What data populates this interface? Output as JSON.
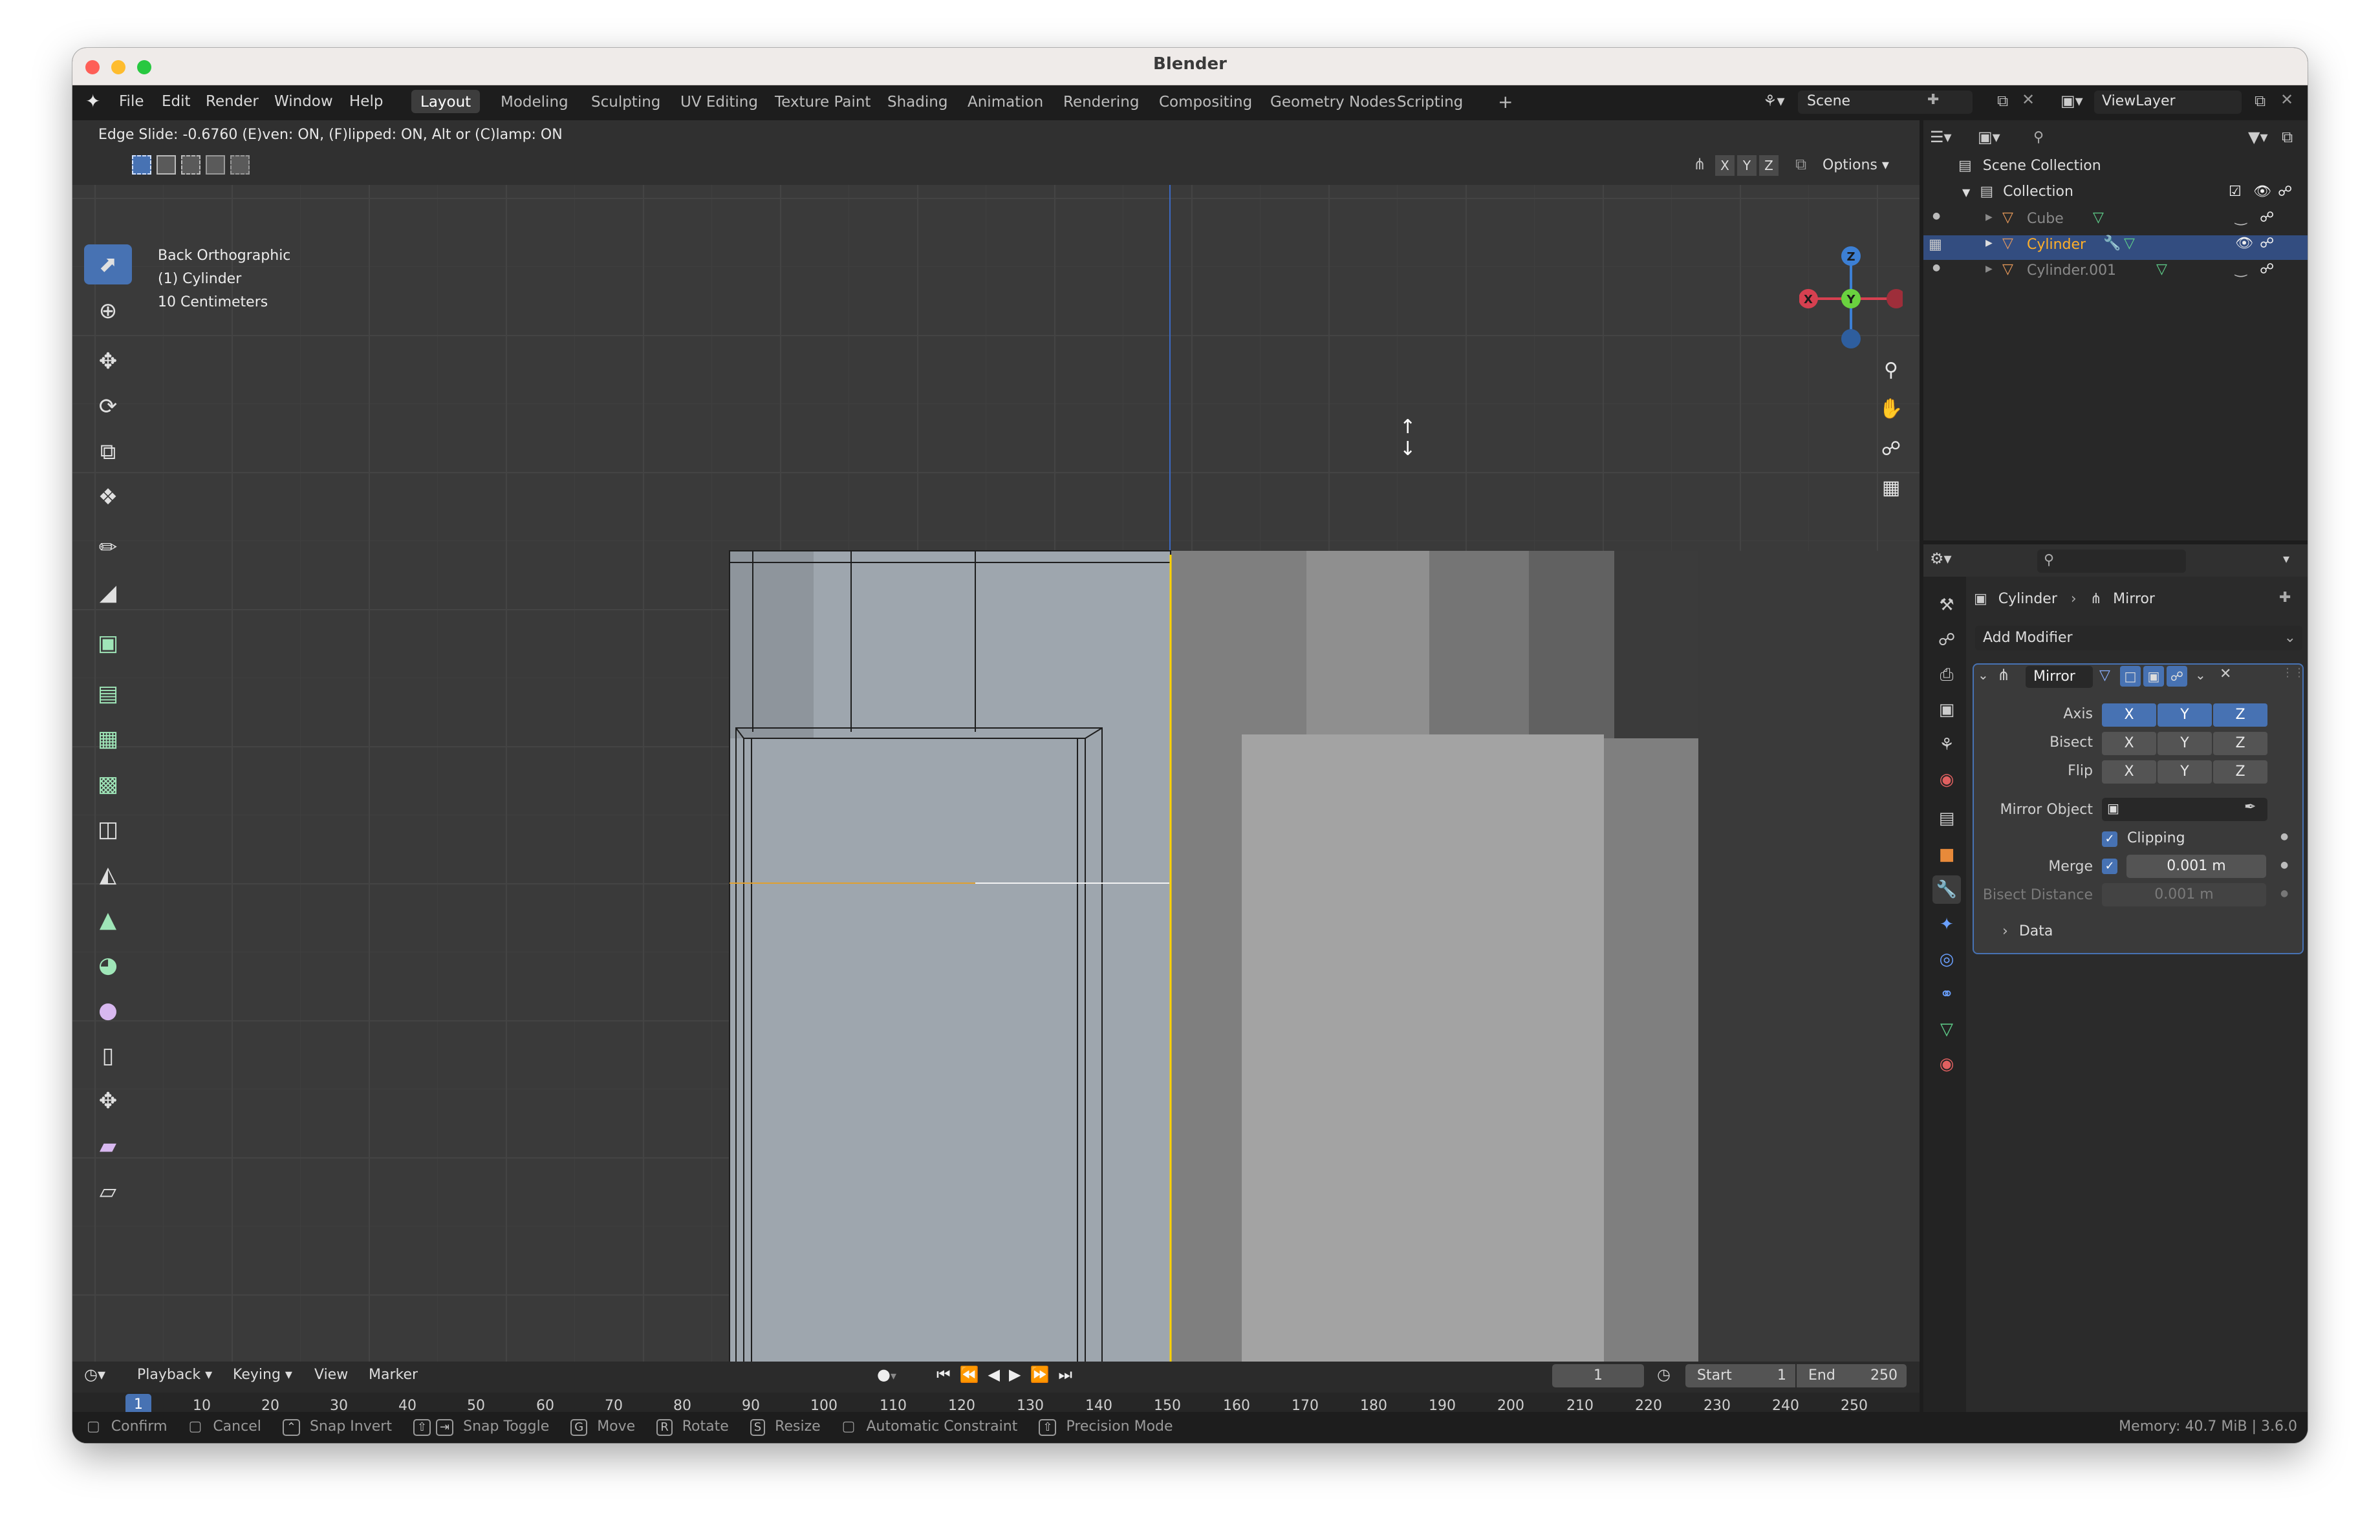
{
  "window": {
    "title": "Blender"
  },
  "menubar": {
    "items": [
      "File",
      "Edit",
      "Render",
      "Window",
      "Help"
    ]
  },
  "workspaces": {
    "tabs": [
      "Layout",
      "Modeling",
      "Sculpting",
      "UV Editing",
      "Texture Paint",
      "Shading",
      "Animation",
      "Rendering",
      "Compositing",
      "Geometry Nodes",
      "Scripting"
    ],
    "active": "Layout",
    "add_label": "+"
  },
  "scene": {
    "name": "Scene",
    "view_layer": "ViewLayer"
  },
  "header_status": "Edge Slide: -0.6760 (E)ven: ON, (F)lipped: ON, Alt or (C)lamp: ON",
  "viewport": {
    "view_name": "Back Orthographic",
    "object_label": "(1) Cylinder",
    "scale_label": "10 Centimeters",
    "axis_x": "X",
    "axis_y": "Y",
    "axis_z": "Z",
    "options_label": "Options",
    "gizmo": {
      "x": "X",
      "y": "Y",
      "z": "Z"
    }
  },
  "outliner": {
    "scene_collection": "Scene Collection",
    "collection": "Collection",
    "objects": [
      {
        "name": "Cube",
        "selected": false
      },
      {
        "name": "Cylinder",
        "selected": true
      },
      {
        "name": "Cylinder.001",
        "selected": false
      }
    ]
  },
  "properties": {
    "breadcrumb_object": "Cylinder",
    "breadcrumb_modifier": "Mirror",
    "add_modifier": "Add Modifier",
    "modifier_name": "Mirror",
    "axis_label": "Axis",
    "bisect_label": "Bisect",
    "flip_label": "Flip",
    "x": "X",
    "y": "Y",
    "z": "Z",
    "mirror_object_label": "Mirror Object",
    "clipping_label": "Clipping",
    "merge_label": "Merge",
    "merge_value": "0.001 m",
    "bisect_distance_label": "Bisect Distance",
    "bisect_distance_value": "0.001 m",
    "data_label": "Data"
  },
  "timeline": {
    "menus": [
      "Playback",
      "Keying",
      "View",
      "Marker"
    ],
    "current_frame": "1",
    "start_label": "Start",
    "start_value": "1",
    "end_label": "End",
    "end_value": "250",
    "playhead": "1",
    "ticks": [
      "10",
      "20",
      "30",
      "40",
      "50",
      "60",
      "70",
      "80",
      "90",
      "100",
      "110",
      "120",
      "130",
      "140",
      "150",
      "160",
      "170",
      "180",
      "190",
      "200",
      "210",
      "220",
      "230",
      "240",
      "250"
    ]
  },
  "statusbar": {
    "confirm": "Confirm",
    "cancel": "Cancel",
    "snap_invert": "Snap Invert",
    "snap_toggle": "Snap Toggle",
    "move_key": "G",
    "move": "Move",
    "rotate_key": "R",
    "rotate": "Rotate",
    "resize_key": "S",
    "resize": "Resize",
    "auto_constraint": "Automatic Constraint",
    "precision": "Precision Mode",
    "memory": "Memory: 40.7 MiB | 3.6.0"
  },
  "colors": {
    "accent": "#4772b3",
    "selected_text": "#ffaf29",
    "edge_active": "#ffd700",
    "x_axis": "#d64050",
    "y_axis": "#6ad13f",
    "z_axis": "#3c7fd4"
  }
}
